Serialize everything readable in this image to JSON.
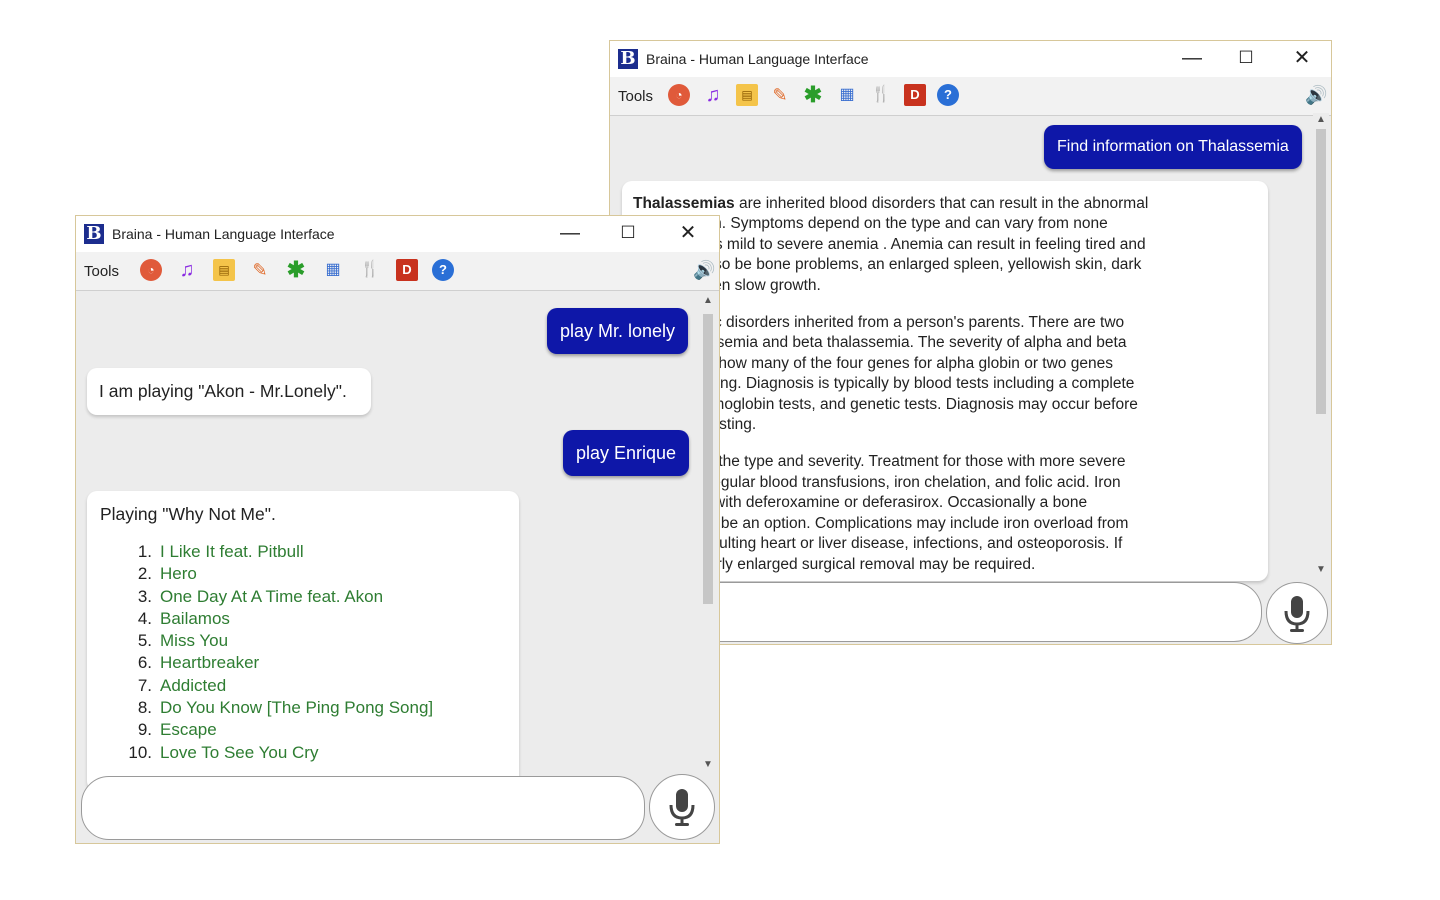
{
  "app": {
    "title": "Braina - Human Language Interface",
    "logo_letter": "B",
    "tools_label": "Tools",
    "minimize": "—",
    "maximize": "☐",
    "close": "✕"
  },
  "icons": {
    "clock": "◔",
    "music": "♫",
    "note": "▤",
    "pin": "✎",
    "star": "✱",
    "doc": "▦",
    "fork": "🍴",
    "dict": "D",
    "help": "?",
    "speaker": "🔊",
    "mic": "🎤",
    "scroll_up": "▲",
    "scroll_down": "▼"
  },
  "colors": {
    "user_bubble": "#0e17a8",
    "song_link": "#2e7d32",
    "window_border": "#d7c79a"
  },
  "right_window": {
    "user_message": "Find information on Thalassemia",
    "response": {
      "term": "Thalassemias",
      "p1_lines": [
        " are inherited blood disorders that can result in the abnormal",
        "f hemoglobin. Symptoms depend on the type and can vary from none",
        "often there is mild to severe anemia . Anemia can result in feeling tired and",
        "here may also be bone problems, an enlarged spleen, yellowish skin, dark",
        "mong children slow growth."
      ],
      "p2_lines": [
        "s are genetic disorders inherited from a person's parents. There are two",
        "alpha thalassemia and beta thalassemia. The severity of alpha and beta",
        "depends on how many of the four genes for alpha globin or two genes",
        "bin are missing. Diagnosis is typically by blood tests including a complete",
        ", special hemoglobin tests, and genetic tests. Diagnosis may occur before",
        "h prenatal testing."
      ],
      "p3_lines": [
        "depends on the type and severity. Treatment for those with more severe",
        "n includes regular blood transfusions, iron chelation, and folic acid. Iron",
        "ay be done with deferoxamine or deferasirox. Occasionally a bone",
        "nsplant may be an option. Complications may include iron overload from",
        "ions with resulting heart or liver disease, infections, and osteoporosis. If",
        "ecomes overly enlarged surgical removal may be required."
      ]
    }
  },
  "left_window": {
    "user_message_1": "play Mr. lonely",
    "bot_reply_1": "I am playing \"Akon - Mr.Lonely\".",
    "user_message_2": "play Enrique",
    "bot_reply_2_heading": "Playing \"Why Not Me\".",
    "songs": [
      {
        "num": "1.",
        "title": "I Like It feat. Pitbull"
      },
      {
        "num": "2.",
        "title": "Hero"
      },
      {
        "num": "3.",
        "title": "One Day At A Time feat. Akon"
      },
      {
        "num": "4.",
        "title": "Bailamos"
      },
      {
        "num": "5.",
        "title": "Miss You"
      },
      {
        "num": "6.",
        "title": "Heartbreaker"
      },
      {
        "num": "7.",
        "title": "Addicted"
      },
      {
        "num": "8.",
        "title": "Do You Know [The Ping Pong Song]"
      },
      {
        "num": "9.",
        "title": "Escape"
      },
      {
        "num": "10.",
        "title": "Love To See You Cry"
      }
    ]
  }
}
